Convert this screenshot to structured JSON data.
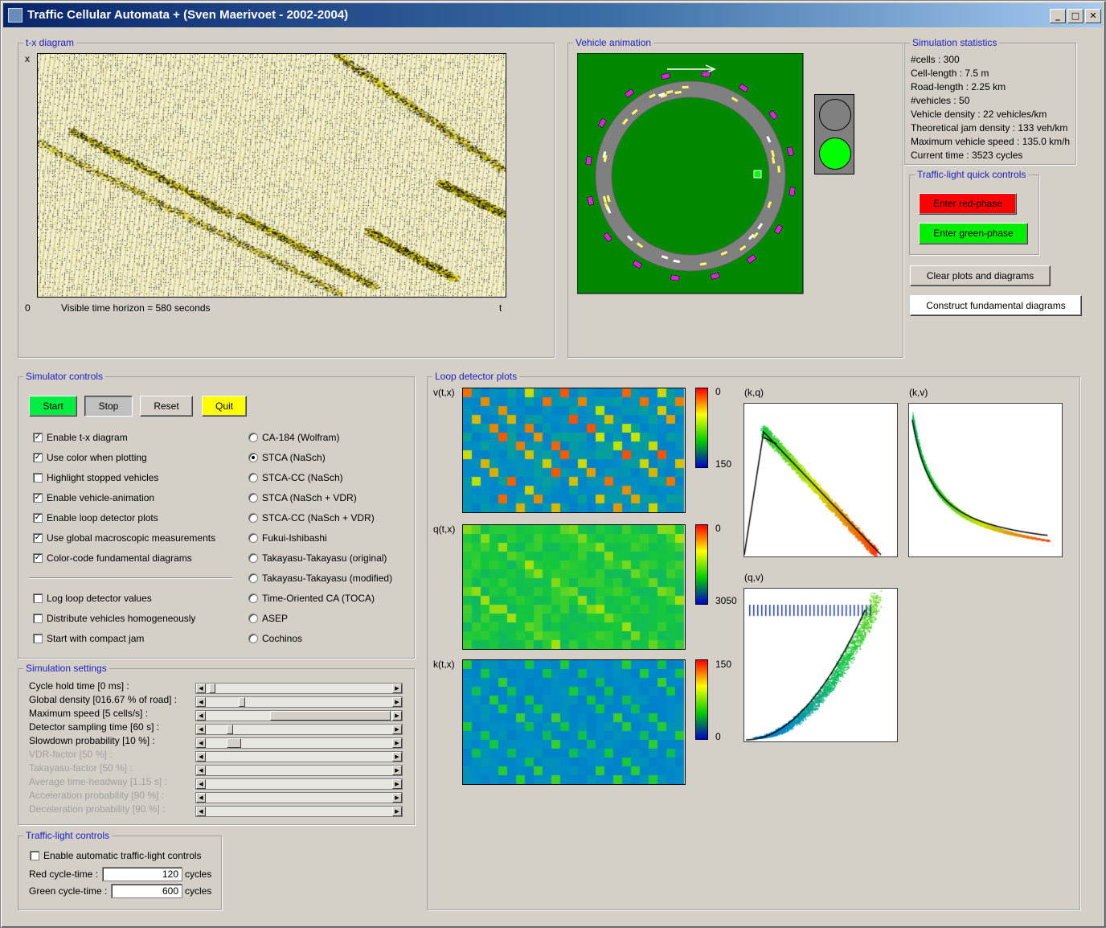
{
  "window": {
    "title": "Traffic Cellular Automata + (Sven Maerivoet - 2002-2004)",
    "minimize": "_",
    "maximize": "□",
    "close": "✕"
  },
  "txdiagram": {
    "legend": "t-x diagram",
    "xaxis": "x",
    "origin": "0",
    "taxis": "t",
    "horizon": "Visible time horizon = 580 seconds"
  },
  "animation": {
    "legend": "Vehicle animation"
  },
  "stats": {
    "legend": "Simulation statistics",
    "lines": [
      "#cells : 300",
      "Cell-length : 7.5 m",
      "Road-length : 2.25 km",
      "#vehicles : 50",
      "Vehicle density : 22 vehicles/km",
      "Theoretical jam density : 133 veh/km",
      "Maximum vehicle speed : 135.0 km/h",
      "Current time : 3523 cycles"
    ]
  },
  "quick": {
    "legend": "Traffic-light quick controls",
    "red": "Enter red-phase",
    "green": "Enter green-phase"
  },
  "actions": {
    "clear": "Clear plots and diagrams",
    "construct": "Construct fundamental diagrams"
  },
  "simctl": {
    "legend": "Simulator controls",
    "start": "Start",
    "stop": "Stop",
    "reset": "Reset",
    "quit": "Quit",
    "options": [
      {
        "label": "Enable t-x diagram",
        "checked": "✓"
      },
      {
        "label": "Use color when plotting",
        "checked": "✓"
      },
      {
        "label": "Highlight stopped vehicles",
        "checked": ""
      },
      {
        "label": "Enable vehicle-animation",
        "checked": "✓"
      },
      {
        "label": "Enable loop detector plots",
        "checked": "✓"
      },
      {
        "label": "Use global macroscopic measurements",
        "checked": "✓"
      },
      {
        "label": "Color-code fundamental diagrams",
        "checked": "✓"
      }
    ],
    "options2": [
      {
        "label": "Log loop detector values",
        "checked": ""
      },
      {
        "label": "Distribute vehicles homogeneously",
        "checked": ""
      },
      {
        "label": "Start with compact jam",
        "checked": ""
      }
    ],
    "models": [
      "CA-184 (Wolfram)",
      "STCA (NaSch)",
      "STCA-CC (NaSch)",
      "STCA (NaSch + VDR)",
      "STCA-CC (NaSch + VDR)",
      "Fukui-Ishibashi",
      "Takayasu-Takayasu (original)",
      "Takayasu-Takayasu (modified)",
      "Time-Oriented CA (TOCA)",
      "ASEP",
      "Cochinos"
    ],
    "selected_model": "STCA (NaSch)"
  },
  "settings": {
    "legend": "Simulation settings",
    "rows": [
      {
        "label": "Cycle hold time [0 ms] :",
        "value": 0.0,
        "enabled": true
      },
      {
        "label": "Global density [016.67 % of road] :",
        "value": 0.17,
        "enabled": true
      },
      {
        "label": "Maximum speed [5 cells/s] :",
        "value": 0.35,
        "enabled": true
      },
      {
        "label": "Detector sampling time [60 s] :",
        "value": 0.1,
        "enabled": true
      },
      {
        "label": "Slowdown probability [10 %] :",
        "value": 0.1,
        "enabled": true
      },
      {
        "label": "VDR-factor [50 %] :",
        "value": 0,
        "enabled": false
      },
      {
        "label": "Takayasu-factor [50 %] :",
        "value": 0,
        "enabled": false
      },
      {
        "label": "Average time-headway [1.15 s] :",
        "value": 0,
        "enabled": false
      },
      {
        "label": "Acceleration probability [90 %] :",
        "value": 0,
        "enabled": false
      },
      {
        "label": "Deceleration probability [90 %] :",
        "value": 0,
        "enabled": false
      }
    ]
  },
  "tlc": {
    "legend": "Traffic-light controls",
    "enable": "Enable automatic traffic-light controls",
    "red_label": "Red cycle-time :",
    "red_value": "120",
    "green_label": "Green cycle-time :",
    "green_value": "600",
    "unit": "cycles"
  },
  "loop": {
    "legend": "Loop detector plots",
    "v": {
      "label": "v(t,x)",
      "top": "0",
      "bottom": "150"
    },
    "q": {
      "label": "q(t,x)",
      "top": "0",
      "bottom": "3050"
    },
    "k": {
      "label": "k(t,x)",
      "top": "150",
      "bottom": "0"
    }
  },
  "fund": {
    "kq": "(k,q)",
    "kv": "(k,v)",
    "qv": "(q,v)"
  },
  "colors": {
    "green_anim": "#008800",
    "red_btn": "#ff0000",
    "green_btn": "#00ee00",
    "start": "#00ee44",
    "quit": "#ffff00",
    "legend_text": "#2020c0"
  }
}
